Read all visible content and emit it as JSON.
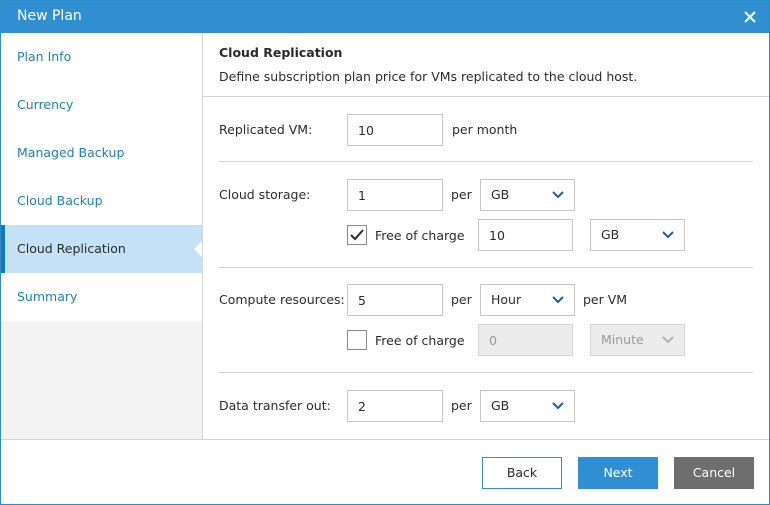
{
  "window": {
    "title": "New Plan"
  },
  "sidebar": {
    "items": [
      {
        "label": "Plan Info"
      },
      {
        "label": "Currency"
      },
      {
        "label": "Managed Backup"
      },
      {
        "label": "Cloud Backup"
      },
      {
        "label": "Cloud Replication"
      },
      {
        "label": "Summary"
      }
    ],
    "active_index": 4
  },
  "header": {
    "title": "Cloud Replication",
    "description": "Define subscription plan price for VMs replicated to the cloud host."
  },
  "replicated_vm": {
    "label": "Replicated VM:",
    "value": "10",
    "suffix": "per month"
  },
  "cloud_storage": {
    "label": "Cloud storage:",
    "value": "1",
    "per": "per",
    "unit": "GB",
    "free_label": "Free of charge",
    "free_checked": true,
    "free_value": "10",
    "free_unit": "GB"
  },
  "compute": {
    "label": "Compute resources:",
    "value": "5",
    "per": "per",
    "unit": "Hour",
    "suffix": "per VM",
    "free_label": "Free of charge",
    "free_checked": false,
    "free_value": "0",
    "free_unit": "Minute"
  },
  "transfer": {
    "label": "Data transfer out:",
    "value": "2",
    "per": "per",
    "unit": "GB"
  },
  "buttons": {
    "back": "Back",
    "next": "Next",
    "cancel": "Cancel"
  },
  "colors": {
    "accent": "#2f8fd0",
    "active_bg": "#c5e1f5",
    "link": "#1f7fb3"
  }
}
